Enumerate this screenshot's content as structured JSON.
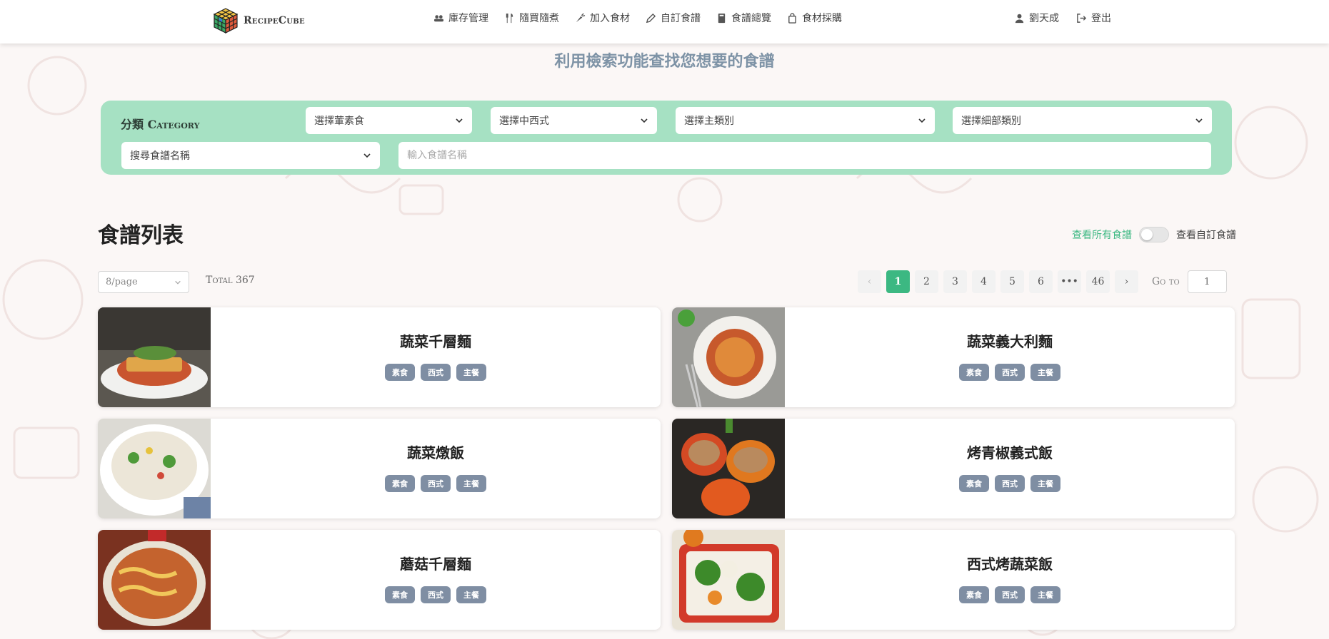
{
  "brand": {
    "name": "RecipeCube"
  },
  "nav": {
    "items": [
      {
        "label": "庫存管理",
        "icon": "group-icon"
      },
      {
        "label": "隨買隨煮",
        "icon": "utensils-icon"
      },
      {
        "label": "加入食材",
        "icon": "carrot-icon"
      },
      {
        "label": "自訂食譜",
        "icon": "pencil-icon"
      },
      {
        "label": "食譜總覽",
        "icon": "book-icon"
      },
      {
        "label": "食材採購",
        "icon": "shopping-bag-icon"
      }
    ],
    "user": "劉天成",
    "logout": "登出"
  },
  "subtitle": "利用檢索功能查找您想要的食譜",
  "filters": {
    "category_label": "分類 Category",
    "veg_select": "選擇葷素食",
    "cuisine_select": "選擇中西式",
    "main_category_select": "選擇主類別",
    "sub_category_select": "選擇細部類別",
    "search_mode_select": "搜尋食譜名稱",
    "search_placeholder": "輸入食譜名稱"
  },
  "list": {
    "title": "食譜列表",
    "toggle_left": "查看所有食譜",
    "toggle_right": "查看自訂食譜",
    "per_page": "8/page",
    "total": "Total 367"
  },
  "pagination": {
    "prev": "‹",
    "pages": [
      "1",
      "2",
      "3",
      "4",
      "5",
      "6",
      "•••",
      "46"
    ],
    "active": "1",
    "next": "›",
    "goto_label": "Go to",
    "goto_value": "1"
  },
  "recipes": [
    {
      "name": "蔬菜千層麵",
      "tags": [
        "素食",
        "西式",
        "主餐"
      ]
    },
    {
      "name": "蔬菜義大利麵",
      "tags": [
        "素食",
        "西式",
        "主餐"
      ]
    },
    {
      "name": "蔬菜燉飯",
      "tags": [
        "素食",
        "西式",
        "主餐"
      ]
    },
    {
      "name": "烤青椒義式飯",
      "tags": [
        "素食",
        "西式",
        "主餐"
      ]
    },
    {
      "name": "蘑菇千層麵",
      "tags": [
        "素食",
        "西式",
        "主餐"
      ]
    },
    {
      "name": "西式烤蔬菜飯",
      "tags": [
        "素食",
        "西式",
        "主餐"
      ]
    }
  ],
  "colors": {
    "accent": "#3cb882",
    "filter_panel": "#a6e1c3",
    "tag": "#7f8ea3",
    "subtitle": "#7e93a6"
  }
}
